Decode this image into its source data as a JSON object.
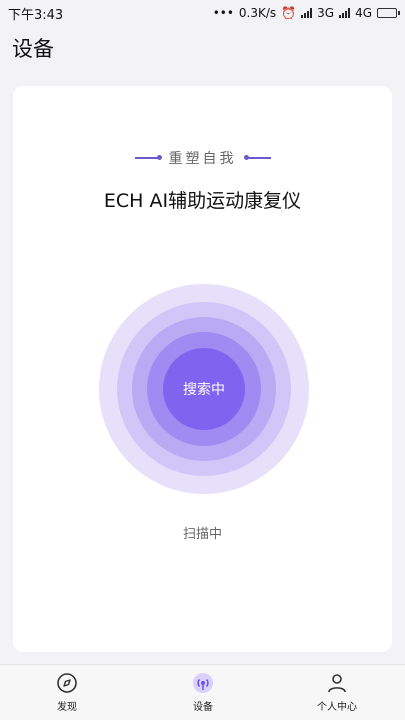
{
  "status_bar": {
    "time": "下午3:43",
    "network_speed": "0.3K/s",
    "network_3g": "3G",
    "network_4g": "4G"
  },
  "header": {
    "title": "设备"
  },
  "card": {
    "slogan": "重塑自我",
    "device_name": "ECH AI辅助运动康复仪",
    "radar_center_label": "搜索中",
    "scan_status": "扫描中"
  },
  "tabs": [
    {
      "label": "发现",
      "icon": "compass-icon",
      "active": false
    },
    {
      "label": "设备",
      "icon": "device-signal-icon",
      "active": true
    },
    {
      "label": "个人中心",
      "icon": "person-icon",
      "active": false
    }
  ],
  "colors": {
    "accent": "#8064ef",
    "ring_light": "#e6e0fb",
    "background": "#f3f3f5"
  }
}
